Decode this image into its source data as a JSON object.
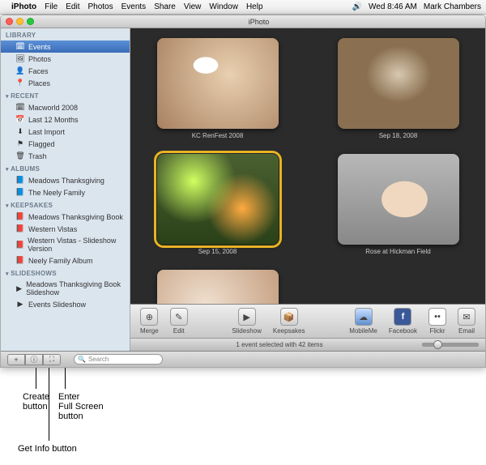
{
  "menubar": {
    "app": "iPhoto",
    "items": [
      "File",
      "Edit",
      "Photos",
      "Events",
      "Share",
      "View",
      "Window",
      "Help"
    ],
    "clock": "Wed 8:46 AM",
    "user": "Mark Chambers"
  },
  "window": {
    "title": "iPhoto"
  },
  "sidebar": {
    "sections": [
      {
        "name": "LIBRARY",
        "items": [
          {
            "label": "Events",
            "glyph": "🗓",
            "selected": true
          },
          {
            "label": "Photos",
            "glyph": "🖼",
            "selected": false
          },
          {
            "label": "Faces",
            "glyph": "👤",
            "selected": false
          },
          {
            "label": "Places",
            "glyph": "📍",
            "selected": false
          }
        ]
      },
      {
        "name": "RECENT",
        "items": [
          {
            "label": "Macworld 2008",
            "glyph": "🗓",
            "selected": false
          },
          {
            "label": "Last 12 Months",
            "glyph": "📅",
            "selected": false
          },
          {
            "label": "Last Import",
            "glyph": "⬇",
            "selected": false
          },
          {
            "label": "Flagged",
            "glyph": "⚑",
            "selected": false
          },
          {
            "label": "Trash",
            "glyph": "🗑",
            "selected": false
          }
        ]
      },
      {
        "name": "ALBUMS",
        "items": [
          {
            "label": "Meadows Thanksgiving",
            "glyph": "📘",
            "selected": false
          },
          {
            "label": "The Neely Family",
            "glyph": "📘",
            "selected": false
          }
        ]
      },
      {
        "name": "KEEPSAKES",
        "items": [
          {
            "label": "Meadows Thanksgiving Book",
            "glyph": "📕",
            "selected": false
          },
          {
            "label": "Western Vistas",
            "glyph": "📕",
            "selected": false
          },
          {
            "label": "Western Vistas - Slideshow Version",
            "glyph": "📕",
            "selected": false
          },
          {
            "label": "Neely Family Album",
            "glyph": "📕",
            "selected": false
          }
        ]
      },
      {
        "name": "SLIDESHOWS",
        "items": [
          {
            "label": "Meadows Thanksgiving Book Slideshow",
            "glyph": "▶",
            "selected": false
          },
          {
            "label": "Events Slideshow",
            "glyph": "▶",
            "selected": false
          }
        ]
      }
    ]
  },
  "events": [
    {
      "caption": "KC RenFest 2008",
      "selected": false,
      "thumb": "t1"
    },
    {
      "caption": "Sep 18, 2008",
      "selected": false,
      "thumb": "t2"
    },
    {
      "caption": "Sep 15, 2008",
      "selected": true,
      "thumb": "t3"
    },
    {
      "caption": "Rose at Hickman Field",
      "selected": false,
      "thumb": "t4"
    },
    {
      "caption": "",
      "selected": false,
      "thumb": "t5"
    }
  ],
  "toolbar": {
    "left": [
      {
        "label": "Merge",
        "glyph": "⊕"
      },
      {
        "label": "Edit",
        "glyph": "✎"
      }
    ],
    "center": [
      {
        "label": "Slideshow",
        "glyph": "▶"
      },
      {
        "label": "Keepsakes",
        "glyph": "📦"
      }
    ],
    "right": [
      {
        "label": "MobileMe",
        "glyph": "☁",
        "cls": "blue"
      },
      {
        "label": "Facebook",
        "glyph": "f",
        "cls": "fb"
      },
      {
        "label": "Flickr",
        "glyph": "••",
        "cls": "flk"
      },
      {
        "label": "Email",
        "glyph": "✉",
        "cls": ""
      }
    ]
  },
  "bottom": {
    "search_placeholder": "Search",
    "status": "1 event selected with 42 items"
  },
  "annotations": {
    "create": "Create\nbutton",
    "getinfo": "Get Info button",
    "fullscreen": "Enter\nFull Screen\nbutton"
  }
}
